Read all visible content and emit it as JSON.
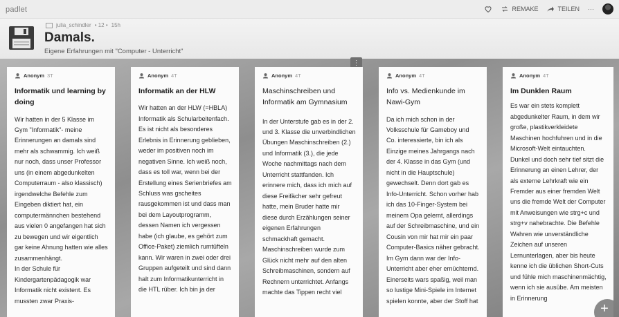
{
  "app": {
    "brand": "padlet"
  },
  "toolbar": {
    "remake_label": "REMAKE",
    "share_label": "TEILEN",
    "more_label": "···"
  },
  "header": {
    "author": "julia_schindler",
    "count": "• 12 •",
    "age": "15h",
    "title": "Damals.",
    "subtitle": "Eigene Erfahrungen mit \"Computer - Unterricht\""
  },
  "menu_chip": "⋮",
  "cards": [
    {
      "author": "Anonym",
      "time": "3T",
      "title": "Informatik und learning by doing",
      "body": "Wir hatten in der 5 Klasse im Gym \"Informatik\"- meine Erinnerungen an damals sind mehr als schwammig. Ich weiß nur noch, dass unser Professor uns (in einem abgedunkelten Computerraum - also klassisch) irgendwelche Befehle zum Eingeben diktiert hat, ein computermännchen bestehend aus vielen 0 angefangen hat sich zu bewegen und wir eigentlich gar keine Ahnung hatten wie alles zusammenhängt.\nIn der Schule für Kindergartenpädagogik war Informatik nicht existent. Es mussten zwar Praxis-"
    },
    {
      "author": "Anonym",
      "time": "4T",
      "title": "Informatik an der HLW",
      "body": "Wir hatten an der HLW (=HBLA) Informatik als Schularbeitenfach. Es ist nicht als besonderes Erlebnis in Erinnerung geblieben, weder im positiven noch im negativen Sinne. Ich weiß noch, dass es toll war, wenn bei der Erstellung eines Serienbriefes am Schluss was gscheites rausgekommen ist und dass man bei dem Layoutprogramm, dessen Namen ich vergessen habe (ich glaube, es gehört zum Office-Paket) ziemlich rumtüfteln kann. Wir waren in zwei oder drei Gruppen aufgeteilt und sind dann halt zum Informatikunterricht in die HTL rüber. Ich bin ja der"
    },
    {
      "author": "Anonym",
      "time": "4T",
      "title": "Maschinschreiben und Informatik am Gymnasium",
      "body": "In der Unterstufe gab es in der 2. und 3. Klasse die unverbindlichen Übungen Maschinschreiben (2.) und Informatik (3.), die jede Woche nachmittags nach dem Unterricht stattfanden. Ich erinnere mich, dass ich mich auf diese Freifächer sehr gefreut hatte, mein Bruder hatte mir diese durch Erzählungen seiner eigenen Erfahrungen schmackhaft gemacht.\nMaschinschreiben wurde zum Glück nicht mehr auf den alten Schreibmaschinen, sondern auf Rechnern unterrichtet. Anfangs machte das Tippen recht viel"
    },
    {
      "author": "Anonym",
      "time": "4T",
      "title": "Info vs. Medienkunde im Nawi-Gym",
      "body": "Da ich mich schon in der Volksschule für Gameboy und Co. interessierte, bin ich als Einzige meines Jahrgangs nach der 4. Klasse in das Gym (und nicht in die Hauptschule) gewechselt. Denn dort gab es Info-Unterricht. Schon vorher hab ich das 10-Finger-System bei meinem Opa gelernt, allerdings auf der Schreibmaschine, und ein Cousin von mir hat mir ein paar Computer-Basics näher gebracht. Im Gym dann war der Info-Unterricht aber eher ernüchternd. Einerseits wars spaßig, weil man so lustige Mini-Spiele im Internet spielen konnte, aber der Stoff hat"
    },
    {
      "author": "Anonym",
      "time": "4T",
      "title": "Im Dunklen Raum",
      "body": "Es war ein stets komplett abgedunkelter Raum, in dem wir große, plastikverkleidete Maschinen hochfuhren und in die Microsoft-Welt eintauchten. Dunkel und doch sehr tief sitzt die Erinnerung an einen Lehrer, der als externe Lehrkraft wie ein Fremder aus einer fremden Welt uns die fremde Welt der Computer mit Anweisungen wie strg+c und strg+v nahebrachte. Die Befehle Wahren wie unverständliche Zeichen auf unseren Lernunterlagen, aber bis heute kenne ich die üblichen Short-Cuts und fühle mich maschinenmächtig, wenn ich sie ausübe. Am meisten in Erinnerung"
    }
  ],
  "fab_label": "+"
}
